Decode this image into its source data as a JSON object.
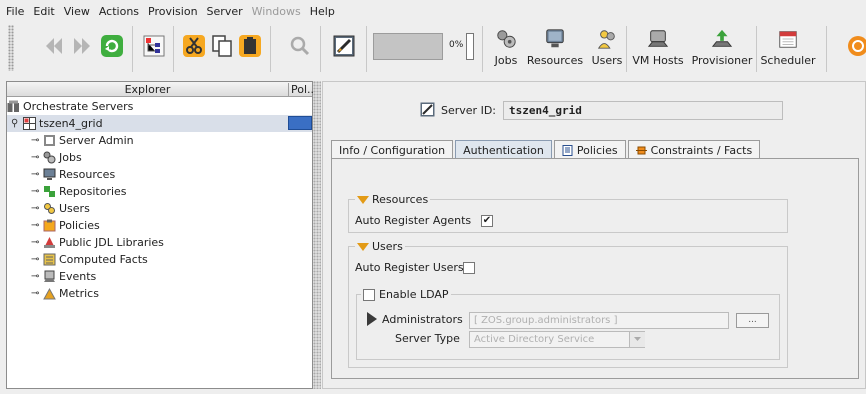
{
  "menu": [
    "File",
    "Edit",
    "View",
    "Actions",
    "Provision",
    "Server",
    "Windows",
    "Help"
  ],
  "toolbar": {
    "progress_percent": "0%",
    "tools": [
      {
        "label": "Jobs",
        "icon": "jobs-icon"
      },
      {
        "label": "Resources",
        "icon": "resources-icon"
      },
      {
        "label": "Users",
        "icon": "users-icon"
      },
      {
        "label": "VM Hosts",
        "icon": "vm-hosts-icon"
      },
      {
        "label": "Provisioner",
        "icon": "provisioner-icon"
      },
      {
        "label": "Scheduler",
        "icon": "scheduler-icon"
      }
    ]
  },
  "explorer": {
    "col1": "Explorer",
    "col2": "Pol...",
    "root": "Orchestrate Servers",
    "grid": "tszen4_grid",
    "items": [
      "Server Admin",
      "Jobs",
      "Resources",
      "Repositories",
      "Users",
      "Policies",
      "Public JDL Libraries",
      "Computed Facts",
      "Events",
      "Metrics"
    ]
  },
  "server": {
    "id_label": "Server ID:",
    "id_value": "tszen4_grid"
  },
  "tabs": [
    "Info / Configuration",
    "Authentication",
    "Policies",
    "Constraints / Facts"
  ],
  "auth": {
    "resources_title": "Resources",
    "auto_register_agents": "Auto Register Agents",
    "auto_register_agents_checked": "✔",
    "users_title": "Users",
    "auto_register_users": "Auto Register Users",
    "enable_ldap": "Enable LDAP",
    "administrators_label": "Administrators",
    "administrators_value": "[ ZOS.group.administrators ]",
    "ellipsis": "...",
    "server_type_label": "Server Type",
    "server_type_value": "Active Directory Service"
  }
}
